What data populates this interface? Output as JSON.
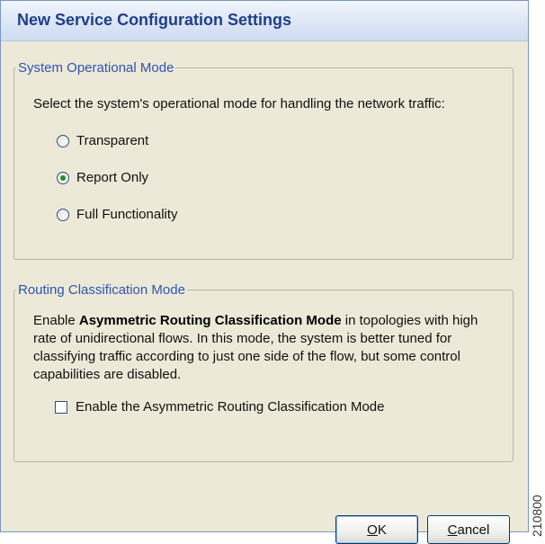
{
  "window": {
    "title": "New Service Configuration Settings"
  },
  "system_mode": {
    "legend": "System Operational Mode",
    "prompt": "Select the system's operational mode for handling the network traffic:",
    "options": [
      {
        "label": "Transparent",
        "checked": false
      },
      {
        "label": "Report Only",
        "checked": true
      },
      {
        "label": "Full Functionality",
        "checked": false
      }
    ]
  },
  "routing_mode": {
    "legend": "Routing Classification Mode",
    "desc_prefix": "Enable ",
    "desc_bold": "Asymmetric Routing Classification Mode",
    "desc_suffix": " in topologies with high rate of unidirectional flows. In this mode, the system is better tuned for classifying traffic according to just one side of the flow, but some control capabilities are disabled.",
    "checkbox_label": "Enable the Asymmetric Routing Classification Mode",
    "checkbox_checked": false
  },
  "buttons": {
    "ok": {
      "mnemonic": "O",
      "rest": "K"
    },
    "cancel": {
      "mnemonic": "C",
      "rest": "ancel"
    }
  },
  "figure_id": "210800"
}
